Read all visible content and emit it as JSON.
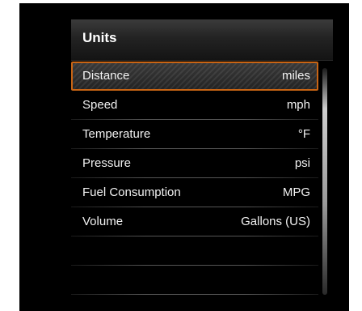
{
  "header": {
    "title": "Units"
  },
  "rows": [
    {
      "label": "Distance",
      "value": "miles"
    },
    {
      "label": "Speed",
      "value": "mph"
    },
    {
      "label": "Temperature",
      "value": "°F"
    },
    {
      "label": "Pressure",
      "value": "psi"
    },
    {
      "label": "Fuel Consumption",
      "value": "MPG"
    },
    {
      "label": "Volume",
      "value": "Gallons (US)"
    }
  ],
  "selected_index": 0,
  "colors": {
    "selection_border": "#c86414",
    "background": "#000000",
    "text": "#f2f2f2"
  }
}
